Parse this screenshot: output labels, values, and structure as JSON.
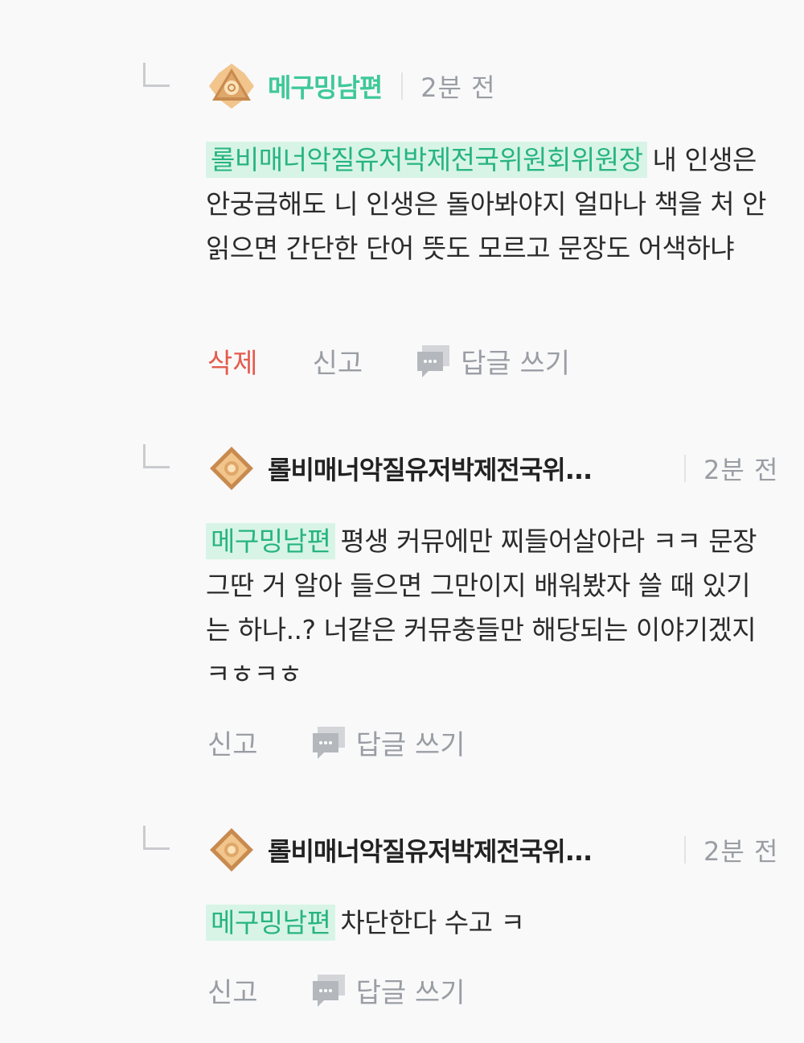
{
  "comments": [
    {
      "author": "메구밍남편",
      "time": "2분 전",
      "mention": "롤비매너악질유저박제전국위원회위원장",
      "text": "내 인생은 안궁금해도 니 인생은 돌아봐야지 얼마나 책을 처 안읽으면 간단한 단어 뜻도 모르고 문장도 어색하냐",
      "actions": {
        "delete": "삭제",
        "report": "신고",
        "reply": "답글 쓰기"
      }
    },
    {
      "author": "롤비매너악질유저박제전국위...",
      "time": "2분 전",
      "mention": "메구밍남편",
      "text": "평생 커뮤에만 찌들어살아라 ㅋㅋ 문장 그딴 거 알아 들으면 그만이지 배워봤자 쓸 때 있기는 하나..? 너같은 커뮤충들만 해당되는 이야기겠지 ㅋㅎㅋㅎ",
      "actions": {
        "report": "신고",
        "reply": "답글 쓰기"
      }
    },
    {
      "author": "롤비매너악질유저박제전국위...",
      "time": "2분 전",
      "mention": "메구밍남편",
      "text": "차단한다 수고 ㅋ",
      "actions": {
        "report": "신고",
        "reply": "답글 쓰기"
      }
    }
  ],
  "colors": {
    "mention_bg": "#d8f4e7",
    "mention_text": "#27b482",
    "author_highlight": "#3fc998",
    "delete": "#e55b4d",
    "muted": "#9a9ea4"
  },
  "icons": [
    "reply-indent-icon",
    "rank-badge-icon",
    "speech-bubble-icon"
  ]
}
